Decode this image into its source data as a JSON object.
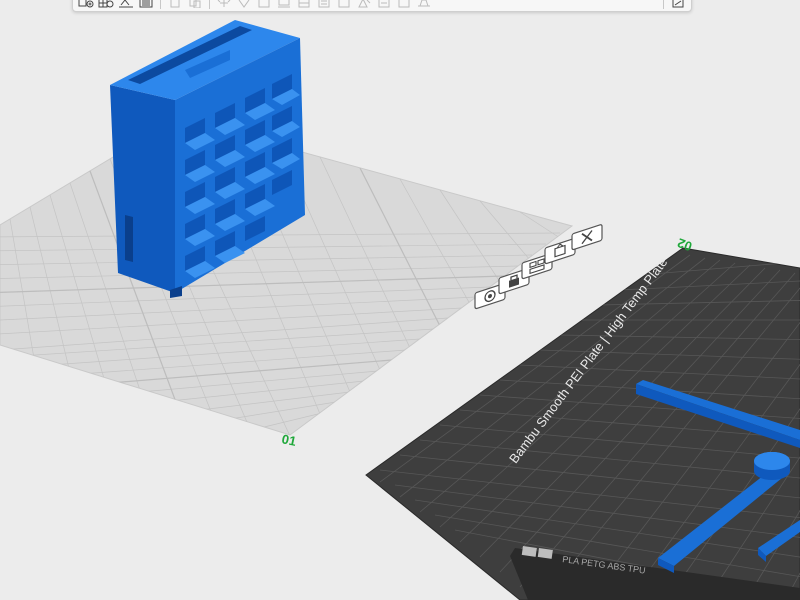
{
  "app": {
    "background": "#ececec",
    "accent": "#1a6fd6"
  },
  "toolbar": {
    "icons": [
      "add-object-icon",
      "add-plate-icon",
      "auto-orient-icon",
      "arrange-icon",
      "copy-icon",
      "paste-icon",
      "rotate-icon",
      "move-icon",
      "scale-icon",
      "lay-on-face-icon",
      "cut-icon",
      "support-paint-icon",
      "seam-paint-icon",
      "color-paint-icon",
      "measure-icon",
      "assembly-icon",
      "variable-layer-icon",
      "split-icon",
      "view-icon"
    ]
  },
  "plates": [
    {
      "id": "plate-1",
      "number": "01",
      "surface": "grid",
      "status_color": "#1fa83a"
    },
    {
      "id": "plate-2",
      "number": "02",
      "surface": "Bambu Smooth PEI Plate | High Temp Plate",
      "status_color": "#1fa83a",
      "front_label": "PLA PETG ABS TPU"
    }
  ],
  "plate_tools": [
    {
      "name": "plate-settings-icon"
    },
    {
      "name": "lock-plate-icon"
    },
    {
      "name": "arrange-plate-icon"
    },
    {
      "name": "auto-orient-plate-icon"
    },
    {
      "name": "delete-plate-icon"
    }
  ],
  "colors": {
    "model": "#1a6fd6",
    "model_dark": "#0f4fa8",
    "model_light": "#2f86ea",
    "plate_light": "#d6d6d6",
    "plate_dark": "#3c3c3c"
  }
}
